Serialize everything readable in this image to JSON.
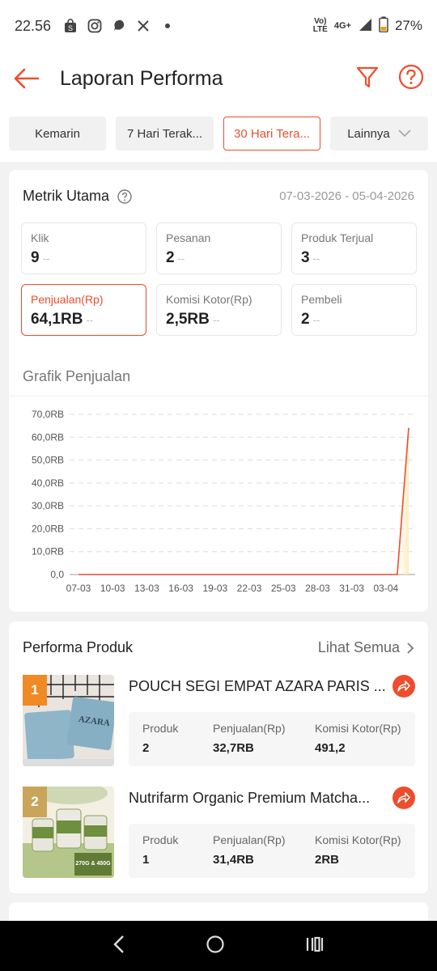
{
  "status_bar": {
    "time": "22.56",
    "network_top": "Vo)",
    "network_bottom": "LTE",
    "signal_label": "4G+",
    "battery": "27%"
  },
  "header": {
    "title": "Laporan Performa",
    "accent_color": "#ee4d2d"
  },
  "filters": [
    {
      "label": "Kemarin",
      "active": false
    },
    {
      "label": "7 Hari Terak...",
      "active": false
    },
    {
      "label": "30 Hari Tera...",
      "active": true
    },
    {
      "label": "Lainnya",
      "active": false
    }
  ],
  "metrics": {
    "title": "Metrik Utama",
    "date_range": "07-03-2026 - 05-04-2026",
    "items": [
      {
        "label": "Klik",
        "value": "9",
        "trend": "--"
      },
      {
        "label": "Pesanan",
        "value": "2",
        "trend": "--"
      },
      {
        "label": "Produk Terjual",
        "value": "3",
        "trend": "--"
      },
      {
        "label": "Penjualan(Rp)",
        "value": "64,1RB",
        "trend": "--"
      },
      {
        "label": "Komisi Kotor(Rp)",
        "value": "2,5RB",
        "trend": "--"
      },
      {
        "label": "Pembeli",
        "value": "2",
        "trend": "--"
      }
    ]
  },
  "chart_title": "Grafik Penjualan",
  "chart_data": {
    "type": "line",
    "y_tick_labels": [
      "0,0",
      "10,0RB",
      "20,0RB",
      "30,0RB",
      "40,0RB",
      "50,0RB",
      "60,0RB",
      "70,0RB"
    ],
    "x_tick_labels": [
      "07-03",
      "10-03",
      "13-03",
      "16-03",
      "19-03",
      "22-03",
      "25-03",
      "28-03",
      "31-03",
      "03-04"
    ],
    "ylim": [
      0,
      70000
    ],
    "grid": true,
    "line_color": "#ee4d2d",
    "series": [
      {
        "x": [
          "07-03",
          "08-03",
          "09-03",
          "10-03",
          "11-03",
          "12-03",
          "13-03",
          "14-03",
          "15-03",
          "16-03",
          "17-03",
          "18-03",
          "19-03",
          "20-03",
          "21-03",
          "22-03",
          "23-03",
          "24-03",
          "25-03",
          "26-03",
          "27-03",
          "28-03",
          "29-03",
          "30-03",
          "31-03",
          "01-04",
          "02-04",
          "03-04",
          "04-04",
          "05-04"
        ],
        "values": [
          0,
          0,
          0,
          0,
          0,
          0,
          0,
          0,
          0,
          0,
          0,
          0,
          0,
          0,
          0,
          0,
          0,
          0,
          0,
          0,
          0,
          0,
          0,
          0,
          0,
          0,
          0,
          0,
          0,
          64100
        ]
      }
    ]
  },
  "products": {
    "title": "Performa Produk",
    "see_all": "Lihat Semua",
    "stat_labels": [
      "Produk",
      "Penjualan(Rp)",
      "Komisi Kotor(Rp)"
    ],
    "items": [
      {
        "rank": "1",
        "name": "POUCH SEGI EMPAT AZARA PARIS ...",
        "produk": "2",
        "penjualan": "32,7RB",
        "komisi": "491,2",
        "rank_color": "#f08a24",
        "thumb_text": "AZARA"
      },
      {
        "rank": "2",
        "name": "Nutrifarm Organic Premium Matcha...",
        "produk": "1",
        "penjualan": "31,4RB",
        "komisi": "2RB",
        "rank_color": "#c9a55b",
        "thumb_text": "270G & 450G"
      }
    ]
  }
}
